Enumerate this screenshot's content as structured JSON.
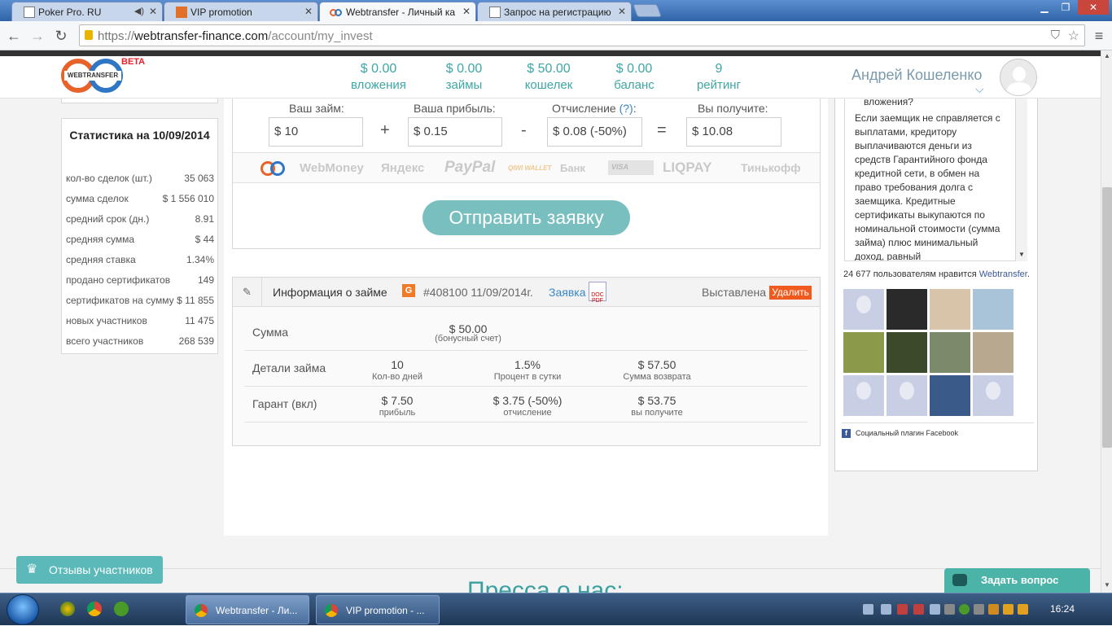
{
  "browser": {
    "tabs": [
      {
        "title": "Poker Pro. RU",
        "active": false
      },
      {
        "title": "VIP promotion",
        "active": false
      },
      {
        "title": "Webtransfer - Личный ка",
        "active": true
      },
      {
        "title": "Запрос на регистрацию",
        "active": false
      }
    ],
    "url_scheme": "https://",
    "url_host": "webtransfer-finance.com",
    "url_path": "/account/my_invest"
  },
  "header": {
    "logo_text": "WEBTRANSFER",
    "beta": "BETA",
    "stats": [
      {
        "value": "$ 0.00",
        "label": "вложения"
      },
      {
        "value": "$ 0.00",
        "label": "займы"
      },
      {
        "value": "$ 50.00",
        "label": "кошелек"
      },
      {
        "value": "$ 0.00",
        "label": "баланс"
      },
      {
        "value": "9",
        "label": "рейтинг"
      }
    ],
    "username": "Андрей Кошеленко",
    "dropdown_glyph": "⌵"
  },
  "left_stats": {
    "title": "Статистика на 10/09/2014",
    "rows": [
      {
        "label": "кол-во сделок (шт.)",
        "value": "35 063"
      },
      {
        "label": "сумма сделок",
        "value": "$ 1 556 010"
      },
      {
        "label": "средний срок (дн.)",
        "value": "8.91"
      },
      {
        "label": "средняя сумма",
        "value": "$ 44"
      },
      {
        "label": "средняя ставка",
        "value": "1.34%"
      },
      {
        "label": "продано сертификатов",
        "value": "149"
      },
      {
        "label": "сертификатов на сумму",
        "value": "$ 11 855"
      },
      {
        "label": "новых участников",
        "value": "11 475"
      },
      {
        "label": "всего участников",
        "value": "268 539"
      }
    ]
  },
  "form": {
    "loan_label": "Ваш займ:",
    "loan_value": "$ 10",
    "profit_label": "Ваша прибыль:",
    "profit_value": "$ 0.15",
    "fee_label": "Отчисление",
    "fee_help": "(?)",
    "fee_colon": ":",
    "fee_value": "$ 0.08 (-50%)",
    "receive_label": "Вы получите:",
    "receive_value": "$ 10.08",
    "op_plus": "+",
    "op_minus": "-",
    "op_equals": "=",
    "payment_systems": [
      "WebMoney",
      "Яндекс",
      "PayPal",
      "QIWI WALLET",
      "Банк",
      "VISA",
      "LIQPAY",
      "Тинькофф"
    ],
    "send_button": "Отправить заявку"
  },
  "loan_info": {
    "title": "Информация о займе",
    "badge": "G",
    "number_date": "#408100 11/09/2014г.",
    "request_link": "Заявка",
    "pdf_label": "DOC PDF",
    "status": "Выставлена",
    "delete_button": "Удалить",
    "rows": {
      "sum": {
        "label": "Сумма",
        "value": "$ 50.00",
        "sub": "(бонусный счет)"
      },
      "details": {
        "label": "Детали займа",
        "cols": [
          {
            "value": "10",
            "sub": "Кол-во дней"
          },
          {
            "value": "1.5%",
            "sub": "Процент в сутки"
          },
          {
            "value": "$ 57.50",
            "sub": "Сумма возврата"
          }
        ]
      },
      "guarantee": {
        "label": "Гарант (вкл)",
        "cols": [
          {
            "value": "$ 7.50",
            "sub": "прибыль"
          },
          {
            "value": "$ 3.75 (-50%)",
            "sub": "отчисление"
          },
          {
            "value": "$ 53.75",
            "sub": "вы получите"
          }
        ]
      }
    }
  },
  "faq": {
    "top_text": "вложения?",
    "body": "Если заемщик не справляется с выплатами, кредитору выплачиваются деньги из средств Гарантийного фонда кредитной сети, в обмен на право требования долга с заемщика. Кредитные сертификаты выкупаются по номинальной стоимости (сумма займа) плюс минимальный доход, равный"
  },
  "facebook": {
    "likes_count": "24 677 пользователям нравится",
    "brand": "Webtransfer",
    "plugin_label": "Социальный плагин Facebook"
  },
  "bottom": {
    "press_heading": "Пресса о нас:",
    "reviews_button": "Отзывы участников",
    "ask_button": "Задать вопрос"
  },
  "taskbar": {
    "items": [
      {
        "title": "Webtransfer - Ли..."
      },
      {
        "title": "VIP promotion - ..."
      }
    ],
    "clock": "16:24"
  },
  "colors": {
    "accent": "#3fa6a6",
    "button": "#79bfbf",
    "delete": "#f05a1e",
    "badge": "#f07a2a"
  }
}
